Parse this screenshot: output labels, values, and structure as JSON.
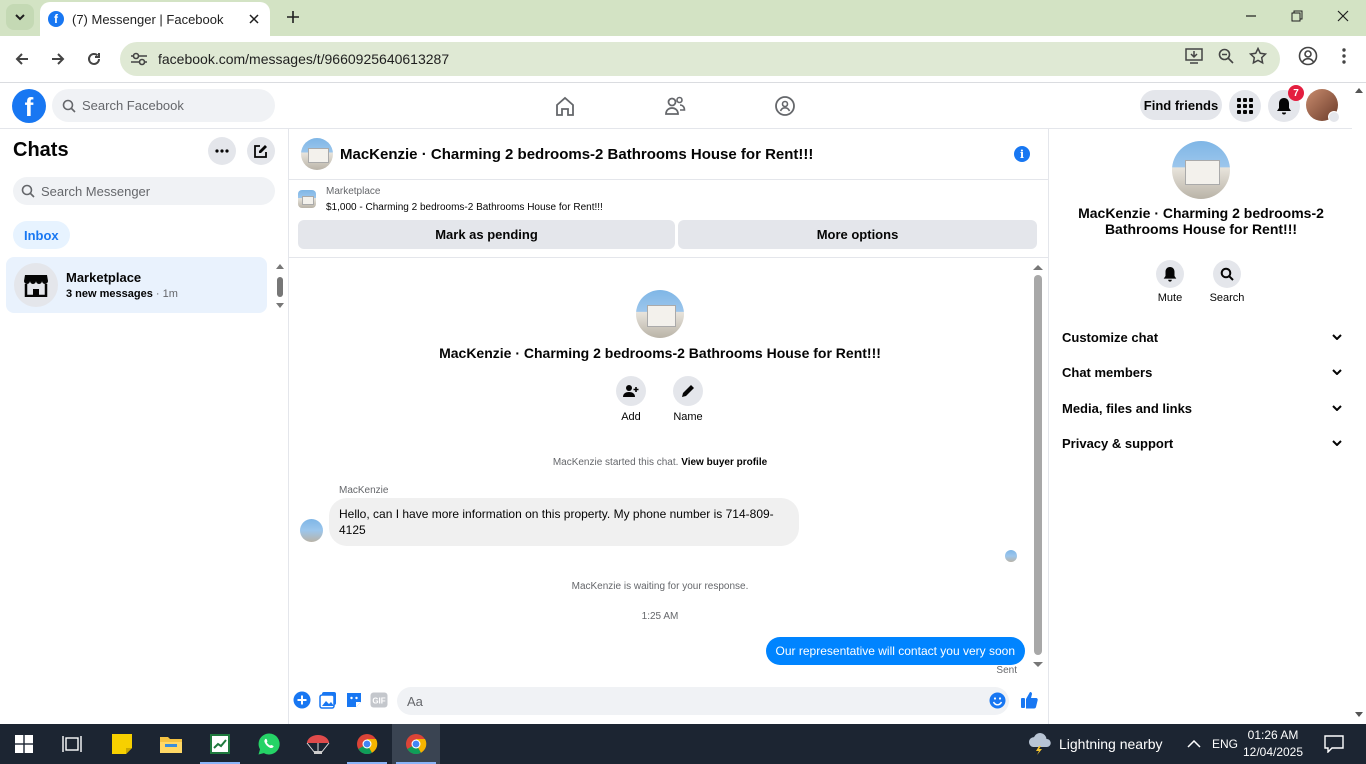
{
  "browser": {
    "tab_title": "(7) Messenger | Facebook",
    "url": "facebook.com/messages/t/9660925640613287"
  },
  "fb_nav": {
    "search_placeholder": "Search Facebook",
    "find_friends_label": "Find friends",
    "notification_count": "7"
  },
  "chats": {
    "title": "Chats",
    "search_placeholder": "Search Messenger",
    "filter_label": "Inbox",
    "items": [
      {
        "name": "Marketplace",
        "preview": "3 new messages",
        "time": " · 1m"
      }
    ]
  },
  "conversation": {
    "title": "MacKenzie · Charming 2 bedrooms-2 Bathrooms House for Rent!!!",
    "marketplace_label": "Marketplace",
    "listing": "$1,000 - Charming 2 bedrooms-2 Bathrooms House for Rent!!!",
    "mark_pending_label": "Mark as pending",
    "more_options_label": "More options",
    "intro_title": "MacKenzie · Charming 2 bedrooms-2 Bathrooms House for Rent!!!",
    "add_label": "Add",
    "name_label": "Name",
    "started_text": "MacKenzie started this chat.",
    "view_profile_label": "View buyer profile",
    "sender_name": "MacKenzie",
    "incoming_message": "Hello, can I have more information on this property. My phone number is 714-809-4125",
    "waiting_text": "MacKenzie is waiting for your response.",
    "timestamp": "1:25 AM",
    "outgoing_message": "Our representative will contact you very soon",
    "sent_status": "Sent",
    "input_placeholder": "Aa"
  },
  "details": {
    "title": "MacKenzie · Charming 2 bedrooms-2 Bathrooms House for Rent!!!",
    "mute_label": "Mute",
    "search_label": "Search",
    "sections": [
      "Customize chat",
      "Chat members",
      "Media, files and links",
      "Privacy & support"
    ]
  },
  "taskbar": {
    "weather": "Lightning nearby",
    "language": "ENG",
    "time": "01:26 AM",
    "date": "12/04/2025"
  },
  "colors": {
    "fb_blue": "#1877f2",
    "messenger_blue": "#0084ff",
    "tab_strip": "#d3e3c4",
    "taskbar": "#1c2532"
  }
}
